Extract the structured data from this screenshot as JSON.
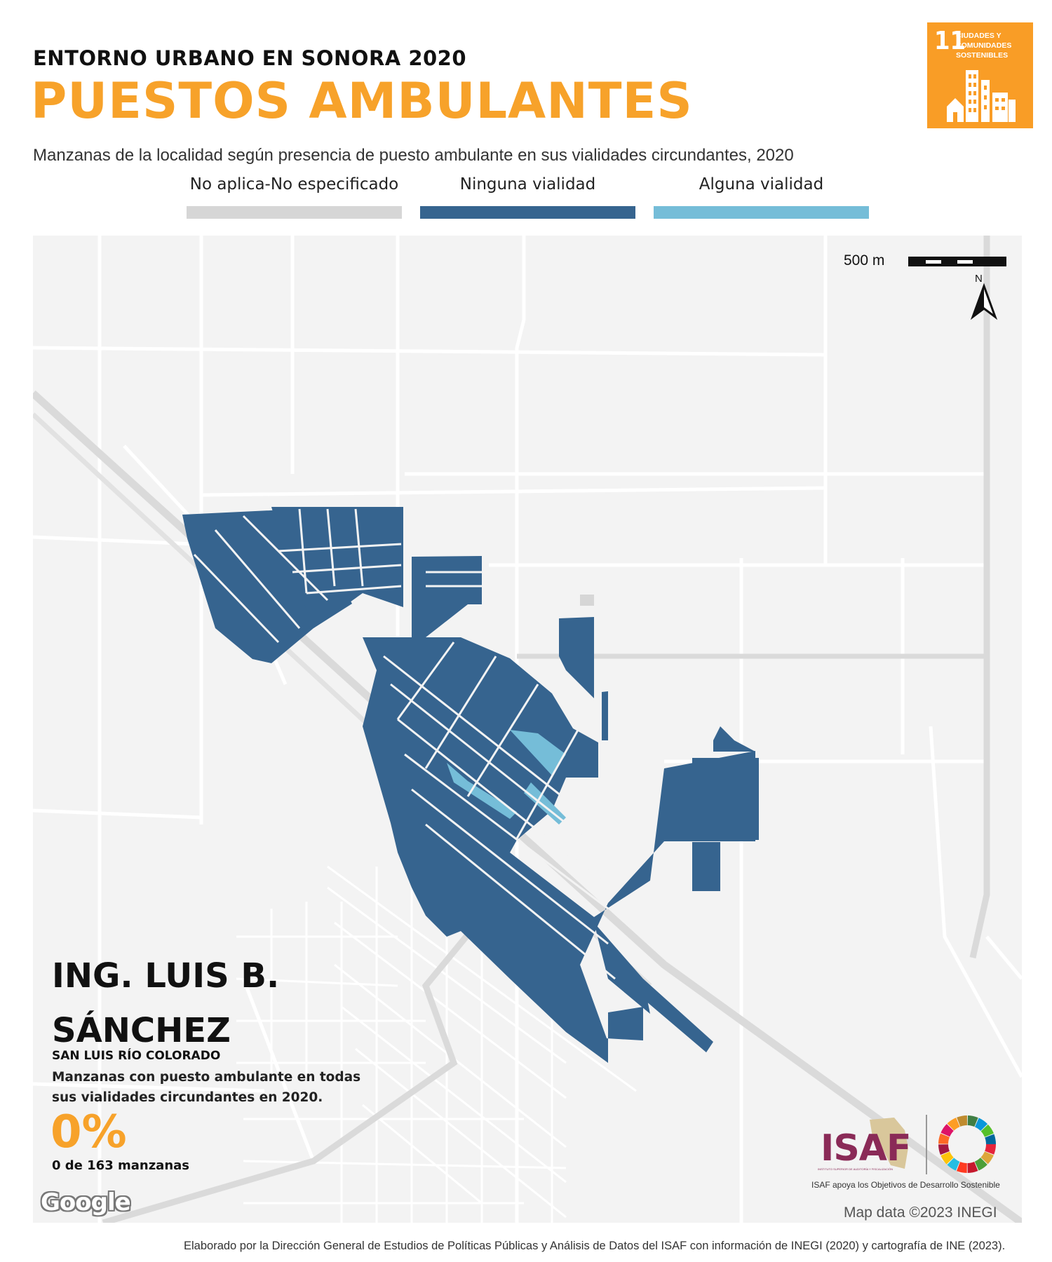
{
  "header": {
    "supertitle": "ENTORNO URBANO EN SONORA 2020",
    "title": "PUESTOS AMBULANTES",
    "subtitle": "Manzanas de la localidad según presencia de puesto ambulante en sus vialidades circundantes, 2020"
  },
  "legend": [
    {
      "label": "No aplica-No especificado",
      "color": "#d6d6d6"
    },
    {
      "label": "Ninguna vialidad",
      "color": "#36648f"
    },
    {
      "label": "Alguna vialidad",
      "color": "#75bdd8"
    }
  ],
  "sdg_badge": {
    "number": "11",
    "text": "CIUDADES Y COMUNIDADES SOSTENIBLES",
    "color": "#f99d26"
  },
  "map": {
    "scale_label": "500 m",
    "north_label": "N",
    "attribution": "Map data ©2023 INEGI",
    "google_logo": "Google"
  },
  "summary": {
    "localidad": "ING. LUIS B. SÁNCHEZ",
    "municipio": "SAN LUIS RÍO COLORADO",
    "description": "Manzanas con puesto ambulante en todas sus vialidades circundantes en 2020.",
    "percent": "0%",
    "count": "0 de 163 manzanas"
  },
  "logos": {
    "isaf": "ISAF",
    "isaf_small": "INSTITUTO SUPERIOR DE AUDITORÍA Y FISCALIZACIÓN",
    "isaf_caption": "ISAF apoya los Objetivos de Desarrollo Sostenible"
  },
  "footer": "Elaborado por la Dirección General de Estudios de Políticas Públicas y Análisis de Datos del ISAF con información de INEGI (2020) y cartografía de INE (2023).",
  "colors": {
    "accent": "#f7a22a",
    "block_none": "#36648f",
    "block_some": "#75bdd8",
    "block_na": "#d6d6d6",
    "isaf": "#8a2a57"
  }
}
